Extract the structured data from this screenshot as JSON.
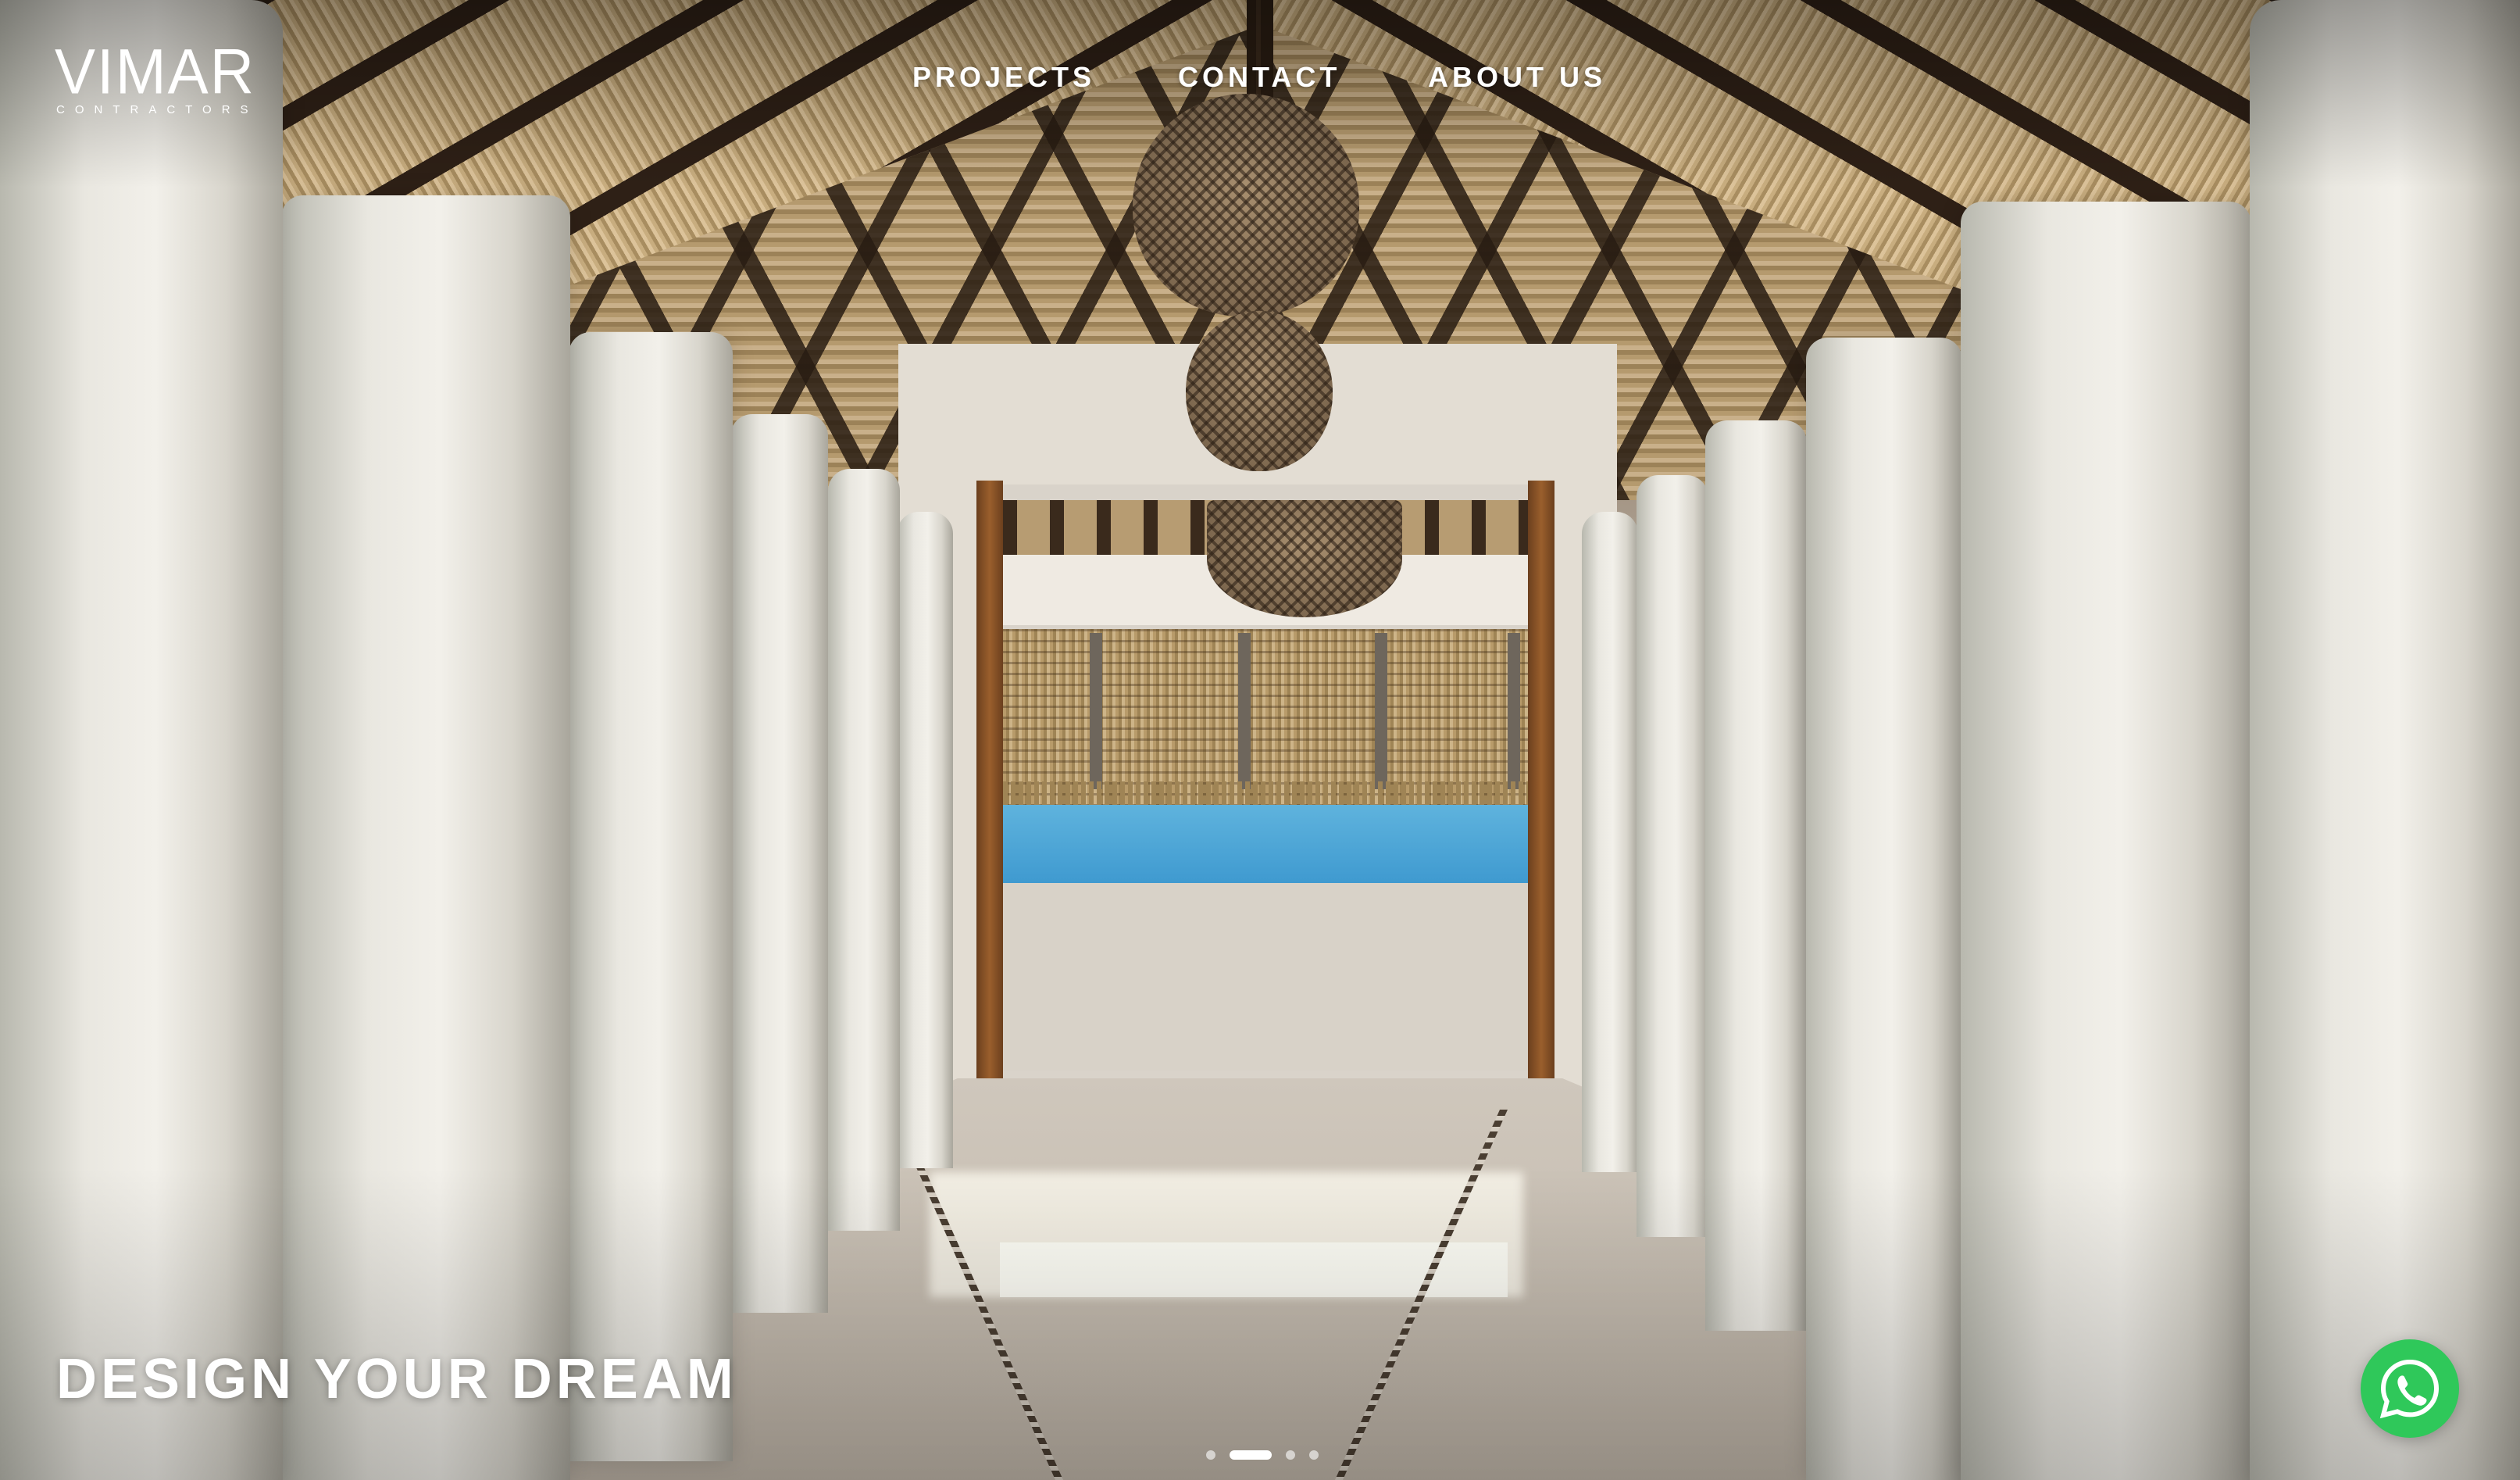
{
  "brand": {
    "name": "VIMAR",
    "subtitle": "CONTRACTORS"
  },
  "nav": {
    "items": [
      {
        "label": "PROJECTS"
      },
      {
        "label": "CONTACT"
      },
      {
        "label": "ABOUT US"
      }
    ]
  },
  "hero": {
    "headline": "DESIGN YOUR DREAM",
    "slider": {
      "total_slides": 4,
      "active_slide": 2
    }
  },
  "floating": {
    "whatsapp_icon": "whatsapp-icon",
    "whatsapp_color": "#2fc85a"
  },
  "colors": {
    "nav_text": "#ffffff",
    "headline": "#ffffff"
  }
}
